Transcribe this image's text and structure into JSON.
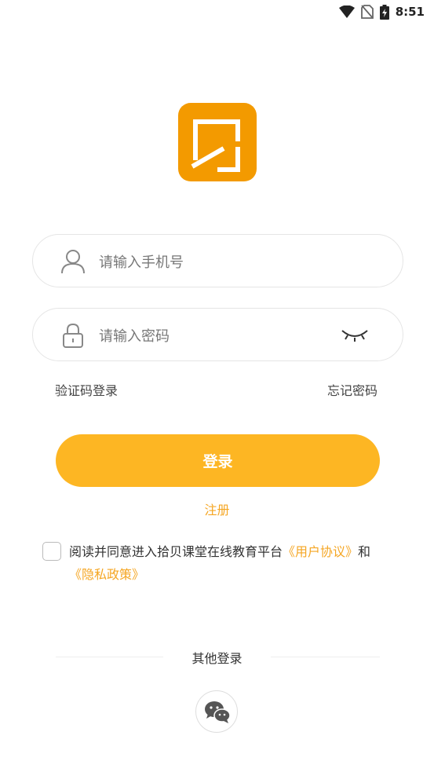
{
  "status_bar": {
    "time": "8:51",
    "icons": [
      "wifi-icon",
      "no-sim-icon",
      "battery-charging-icon"
    ]
  },
  "logo": {
    "icon": "app-logo",
    "color": "#F39A00"
  },
  "phone_field": {
    "placeholder": "请输入手机号",
    "value": "",
    "icon": "user-icon"
  },
  "password_field": {
    "placeholder": "请输入密码",
    "value": "",
    "icon": "lock-icon",
    "toggle_icon": "eye-closed-icon"
  },
  "links": {
    "sms_login": "验证码登录",
    "forgot_password": "忘记密码"
  },
  "login_button": {
    "label": "登录",
    "color": "#FDB623"
  },
  "register_link": "注册",
  "agreement": {
    "checked": false,
    "prefix": "阅读并同意进入拾贝课堂在线教育平台",
    "user_agreement": "《用户协议》",
    "conjunction": "和",
    "privacy_policy": "《隐私政策》"
  },
  "other_login": {
    "label": "其他登录",
    "providers": [
      "wechat-icon"
    ]
  },
  "colors": {
    "accent": "#FDB623",
    "link": "#F5A623"
  }
}
